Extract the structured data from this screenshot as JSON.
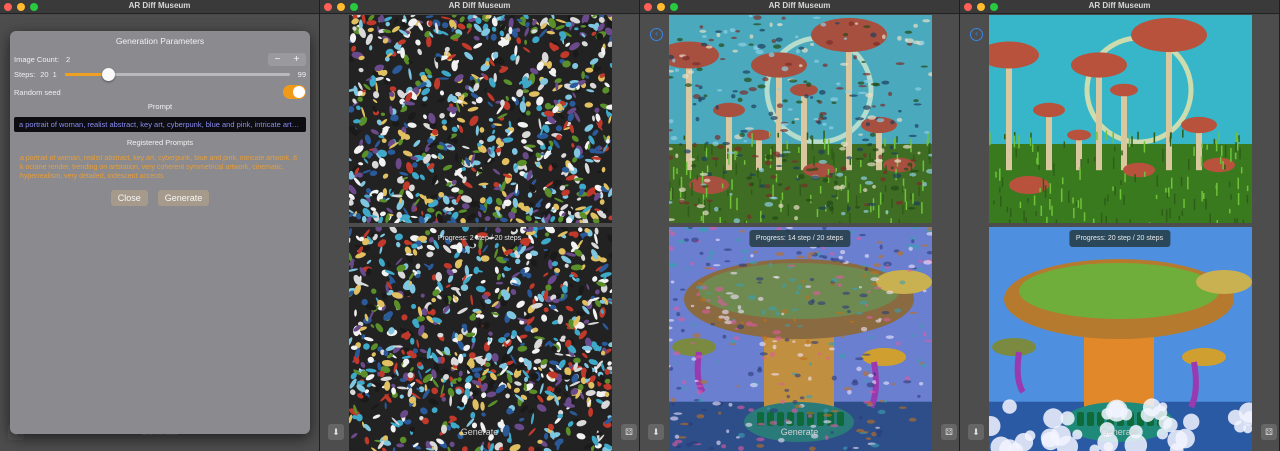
{
  "app_title": "AR Diff Museum",
  "colors": {
    "accent": "#f09a1a",
    "link": "#3a86e8",
    "prompt_text": "#8a8df0"
  },
  "panel": {
    "title": "Generation Parameters",
    "image_count_label": "Image Count:",
    "image_count_value": "2",
    "minus": "−",
    "plus": "+",
    "steps_label": "Steps:",
    "steps_value": "20",
    "steps_min": "1",
    "steps_max": "99",
    "steps_fraction": 0.194,
    "random_seed_label": "Random seed",
    "random_seed_on": true,
    "prompt_label": "Prompt",
    "prompt_value": "a portrait of woman, realist abstract, key art, cyberpunk, blue and pink, intricate artwork",
    "registered_label": "Registered Prompts",
    "registered_text": "a portrait of woman, realist abstract, key art, cyberpunk, blue and pink, intricate artwork, 8 k octane render, trending on artstation, very coherent symmetrical artwork, cinematic, hyperrealism, very detailed, iridescent accents",
    "close_label": "Close",
    "generate_label": "Generate"
  },
  "windows": [
    {
      "progress": "",
      "generate": "Generate"
    },
    {
      "progress": "Progress: 2 step / 20 steps",
      "generate": "Generate"
    },
    {
      "progress": "Progress: 14 step / 20 steps",
      "generate": "Generate"
    },
    {
      "progress": "Progress: 20 step / 20 steps",
      "generate": "Generate"
    }
  ],
  "icons": {
    "back": "back-circle-icon",
    "save": "save-icon",
    "settings": "dice-icon"
  }
}
